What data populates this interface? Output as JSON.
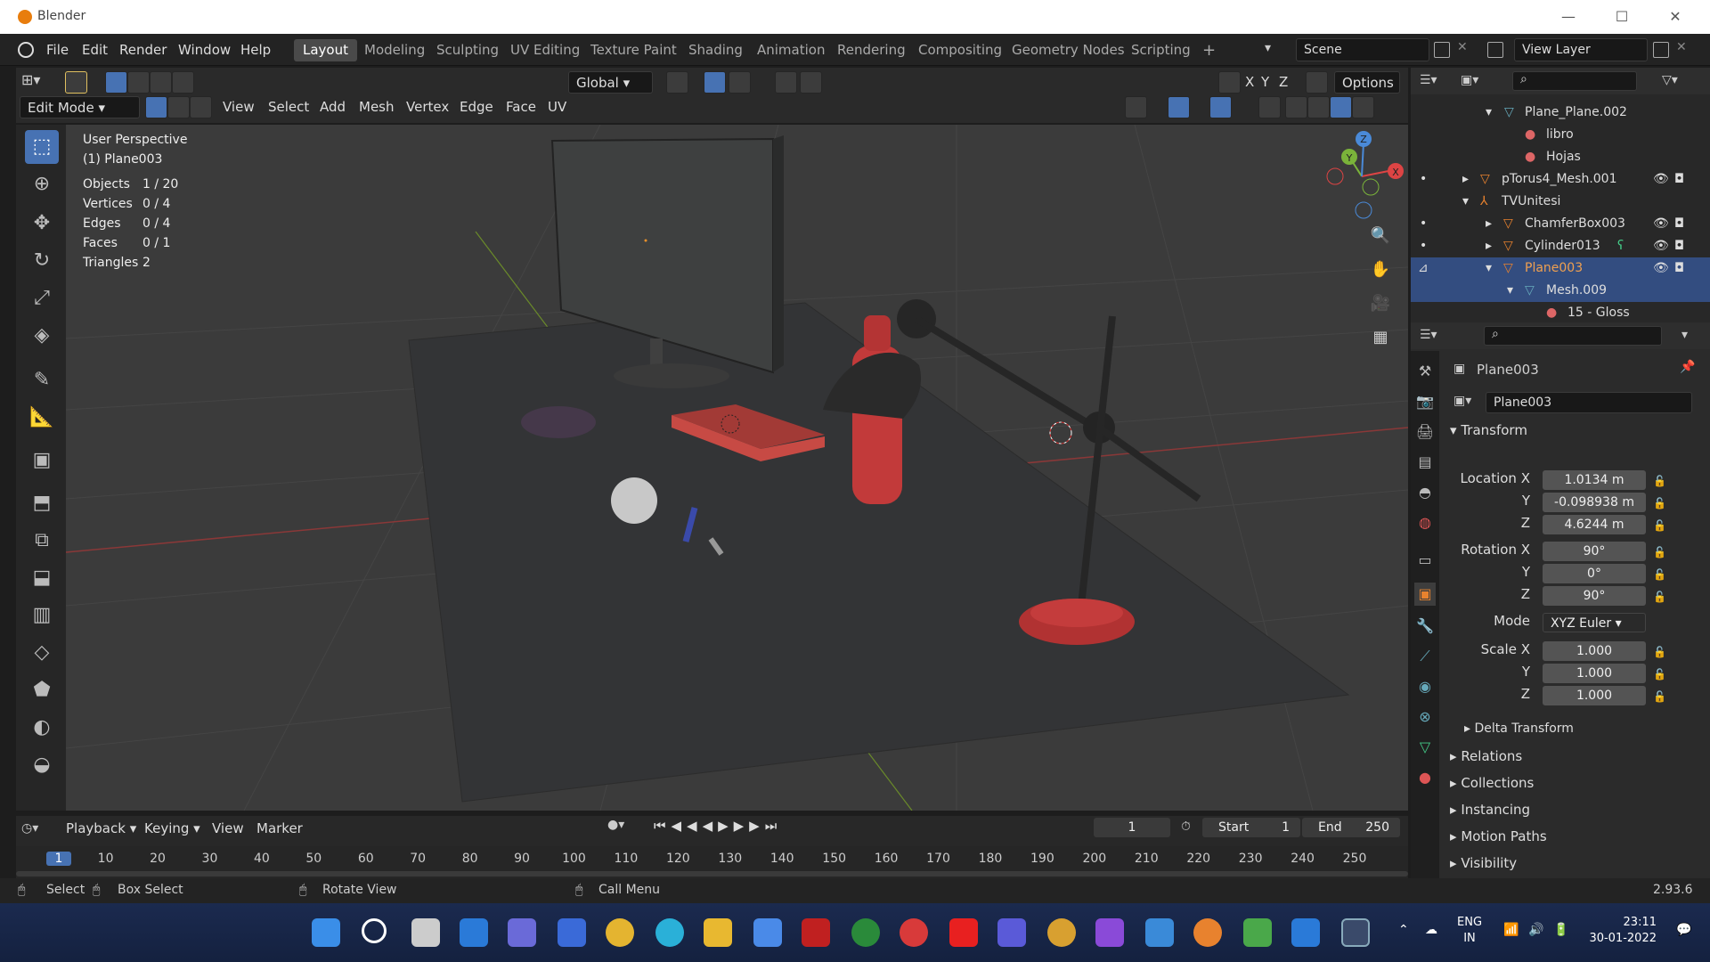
{
  "window": {
    "title": "Blender",
    "minimize": "—",
    "maximize": "☐",
    "close": "✕"
  },
  "menu": {
    "items": [
      "File",
      "Edit",
      "Render",
      "Window",
      "Help"
    ]
  },
  "workspaces": [
    "Layout",
    "Modeling",
    "Sculpting",
    "UV Editing",
    "Texture Paint",
    "Shading",
    "Animation",
    "Rendering",
    "Compositing",
    "Geometry Nodes",
    "Scripting",
    "+"
  ],
  "scene": {
    "label": "Scene",
    "view_layer": "View Layer"
  },
  "header": {
    "transform_orientation": "Global",
    "options": "Options",
    "mode": "Edit Mode",
    "menus": [
      "View",
      "Select",
      "Add",
      "Mesh",
      "Vertex",
      "Edge",
      "Face",
      "UV"
    ],
    "axes": [
      "X",
      "Y",
      "Z"
    ]
  },
  "viewport": {
    "title": "User Perspective",
    "object": "(1) Plane003",
    "stats": [
      {
        "k": "Objects",
        "v": "1 / 20"
      },
      {
        "k": "Vertices",
        "v": "0 / 4"
      },
      {
        "k": "Edges",
        "v": "0 / 4"
      },
      {
        "k": "Faces",
        "v": "0 / 1"
      },
      {
        "k": "Triangles",
        "v": "2"
      }
    ],
    "gizmo": {
      "x": "X",
      "y": "Y",
      "z": "Z"
    }
  },
  "outliner": {
    "rows": [
      {
        "label": "Plane_Plane.002",
        "icon": "mesh-icon"
      },
      {
        "label": "libro",
        "icon": "material-icon"
      },
      {
        "label": "Hojas",
        "icon": "material-icon"
      },
      {
        "label": "pTorus4_Mesh.001",
        "icon": "object-icon"
      },
      {
        "label": "TVUnitesi",
        "icon": "empty-icon"
      },
      {
        "label": "ChamferBox003",
        "icon": "object-icon"
      },
      {
        "label": "Cylinder013",
        "icon": "object-icon"
      },
      {
        "label": "Plane003",
        "icon": "object-icon"
      },
      {
        "label": "Mesh.009",
        "icon": "mesh-icon"
      },
      {
        "label": "15 - Gloss",
        "icon": "material-icon"
      }
    ]
  },
  "properties": {
    "object_name": "Plane003",
    "datablock": "Plane003",
    "transform_title": "Transform",
    "location_label": "Location X",
    "location": {
      "x": "1.0134 m",
      "y": "-0.098938 m",
      "z": "4.6244 m"
    },
    "rotation_label": "Rotation X",
    "rotation": {
      "x": "90°",
      "y": "0°",
      "z": "90°"
    },
    "mode_label": "Mode",
    "mode": "XYZ Euler",
    "scale_label": "Scale X",
    "scale": {
      "x": "1.000",
      "y": "1.000",
      "z": "1.000"
    },
    "y_label": "Y",
    "z_label": "Z",
    "sections": [
      "Delta Transform",
      "Relations",
      "Collections",
      "Instancing",
      "Motion Paths",
      "Visibility"
    ]
  },
  "timeline": {
    "menus": [
      "Playback",
      "Keying",
      "View",
      "Marker"
    ],
    "current_frame": "1",
    "start_label": "Start",
    "start": "1",
    "end_label": "End",
    "end": "250",
    "ticks": [
      "1",
      "10",
      "20",
      "30",
      "40",
      "50",
      "60",
      "70",
      "80",
      "90",
      "100",
      "110",
      "120",
      "130",
      "140",
      "150",
      "160",
      "170",
      "180",
      "190",
      "200",
      "210",
      "220",
      "230",
      "240",
      "250"
    ]
  },
  "statusbar": {
    "select": "Select",
    "box_select": "Box Select",
    "rotate": "Rotate View",
    "call_menu": "Call Menu",
    "version": "2.93.6"
  },
  "taskbar": {
    "lang1": "ENG",
    "lang2": "IN",
    "time": "23:11",
    "date": "30-01-2022"
  },
  "colors": {
    "accent": "#4772b3",
    "selection": "#334d80",
    "object_orange": "#e8822e",
    "red": "#c23a3a"
  }
}
